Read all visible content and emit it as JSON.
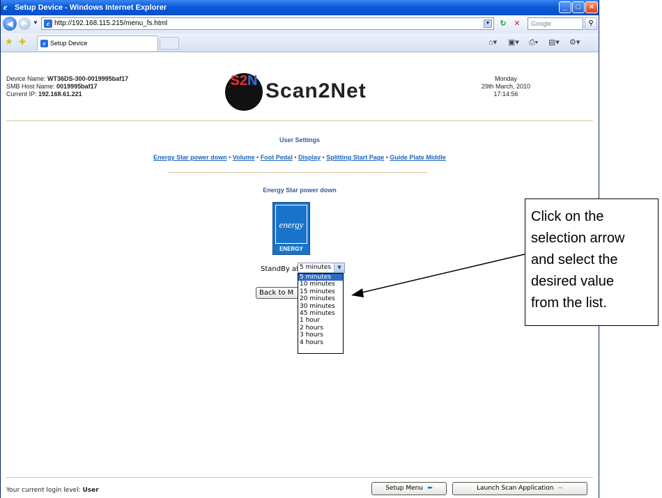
{
  "window": {
    "title": "Setup Device - Windows Internet Explorer",
    "url": "http://192.168.115.215/menu_fs.html",
    "search_placeholder": "Google",
    "tab_label": "Setup Device"
  },
  "device": {
    "name_label": "Device Name:",
    "name_value": "WT36DS-300-0019995baf17",
    "host_label": "SMB Host Name:",
    "host_value": "0019995baf17",
    "ip_label": "Current IP:",
    "ip_value": "192.168.61.221"
  },
  "logo": {
    "mark_s": "S",
    "mark_2": "2",
    "mark_n": "N",
    "text": "Scan2Net"
  },
  "datetime": {
    "day": "Monday",
    "date": "29th March, 2010",
    "time": "17:14:56"
  },
  "page": {
    "section_title": "User Settings",
    "links": [
      "Energy Star power down",
      "Volume",
      "Foot Pedal",
      "Display",
      "Splitting Start Page",
      "Guide Plate Middle"
    ],
    "separator": "•",
    "subsection_title": "Energy Star power down",
    "energy_star_label": "ENERGY STAR",
    "energy_star_script": "energy",
    "standby_label": "StandBy after",
    "standby_selected": "5 minutes",
    "standby_options": [
      "5 minutes",
      "10 minutes",
      "15 minutes",
      "20 minutes",
      "30 minutes",
      "45 minutes",
      "1 hour",
      "2 hours",
      "3 hours",
      "4 hours"
    ],
    "back_button": "Back to M"
  },
  "footer": {
    "login_prefix": "Your current login level:",
    "login_level": "User",
    "setup_menu_button": "Setup Menu",
    "launch_button": "Launch Scan Application"
  },
  "callout": {
    "text": "Click on the selection arrow and select the desired value from the list.",
    "lines": [
      "Click on the",
      "selection arrow",
      "and select the",
      "desired value",
      "from the list."
    ]
  },
  "icons": [
    "ie-icon",
    "back-arrow-icon",
    "forward-arrow-icon",
    "page-icon",
    "refresh-icon",
    "stop-icon",
    "search-icon",
    "favorites-star-icon",
    "add-favorites-icon",
    "home-icon",
    "feeds-icon",
    "print-icon",
    "page-menu-icon",
    "tools-icon",
    "energy-star-logo",
    "left-arrow-icon",
    "right-arrow-icon"
  ],
  "colors": {
    "titlebar": "#0b5ad8",
    "link": "#1a66c0",
    "heading": "#3a5a9a",
    "selected_option": "#316ac5",
    "divider": "#d8c49c"
  }
}
